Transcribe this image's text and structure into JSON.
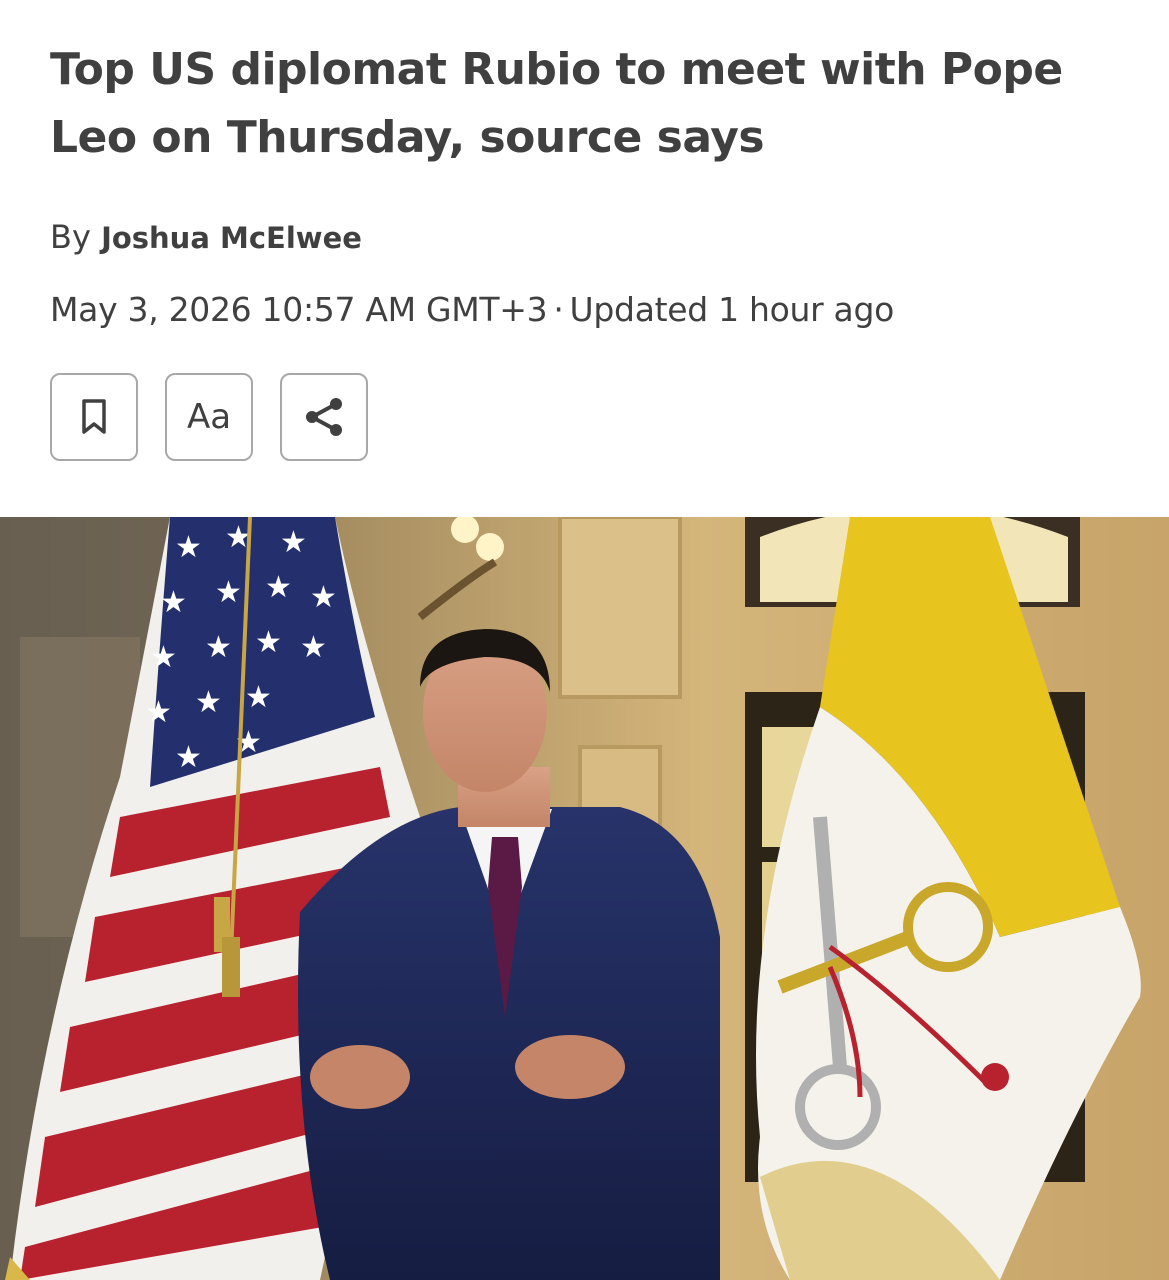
{
  "article": {
    "headline": "Top US diplomat Rubio to meet with Pope Leo on Thursday, source says",
    "byline_prefix": "By",
    "author": "Joshua McElwee",
    "date": "May 3, 2026 10:57 AM GMT+3",
    "separator": "·",
    "updated": "Updated 1 hour ago"
  },
  "toolbar": {
    "font_size_label": "Aa",
    "buttons": [
      {
        "name": "bookmark",
        "icon": "bookmark-icon"
      },
      {
        "name": "text-size",
        "icon": "text-size-icon"
      },
      {
        "name": "share",
        "icon": "share-icon"
      }
    ]
  },
  "hero_image": {
    "description_icon": "photo",
    "colors": {
      "suit": "#1f2a55",
      "tie": "#5a1a45",
      "vatican_yellow": "#e8c41e",
      "vatican_white": "#f4f2ea",
      "us_red": "#b8212e",
      "us_blue": "#24306e",
      "wall": "#c9a96a"
    }
  }
}
